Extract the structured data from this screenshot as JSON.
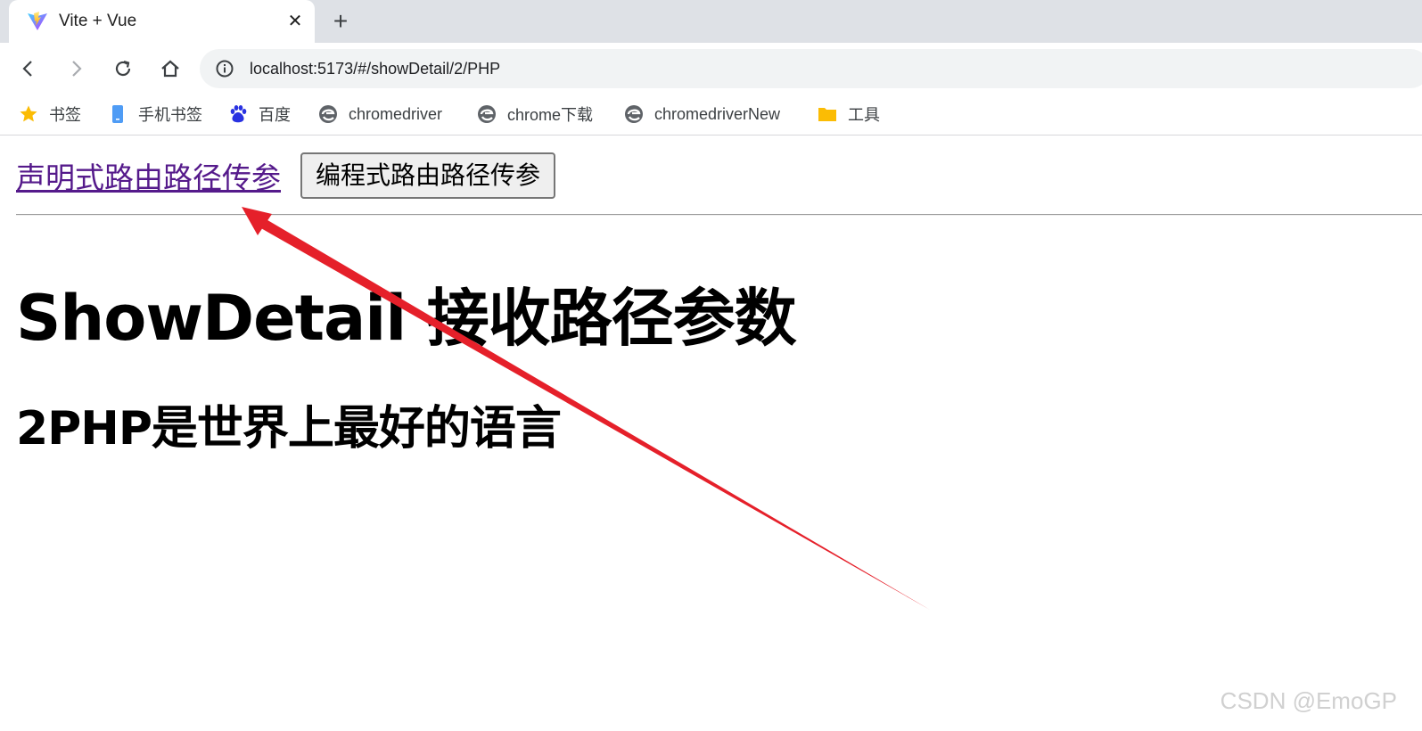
{
  "browser": {
    "tab": {
      "title": "Vite + Vue",
      "favicon": "vite-logo",
      "close": "✕"
    },
    "new_tab": "+",
    "toolbar": {
      "back_icon": "back-arrow-icon",
      "forward_icon": "forward-arrow-icon",
      "reload_icon": "reload-icon",
      "home_icon": "home-icon",
      "url": "localhost:5173/#/showDetail/2/PHP"
    },
    "bookmarks": [
      {
        "label": "书签",
        "icon": "star-icon"
      },
      {
        "label": "手机书签",
        "icon": "phone-icon"
      },
      {
        "label": "百度",
        "icon": "baidu-paw-icon"
      },
      {
        "label": "chromedriver",
        "icon": "edge-style-icon"
      },
      {
        "label": "chrome下载",
        "icon": "edge-style-icon"
      },
      {
        "label": "chromedriverNew",
        "icon": "edge-style-icon"
      },
      {
        "label": "工具",
        "icon": "folder-icon"
      }
    ]
  },
  "page": {
    "declarative_link": "声明式路由路径传参",
    "programmatic_button": "编程式路由路径传参",
    "heading": "ShowDetail 接收路径参数",
    "subheading": "2PHP是世界上最好的语言"
  },
  "watermark": "CSDN @EmoGP",
  "colors": {
    "link_visited": "#551a8b",
    "annotation_arrow": "#e5202a",
    "tabstrip": "#dee1e6",
    "omnibox": "#f1f3f4"
  }
}
